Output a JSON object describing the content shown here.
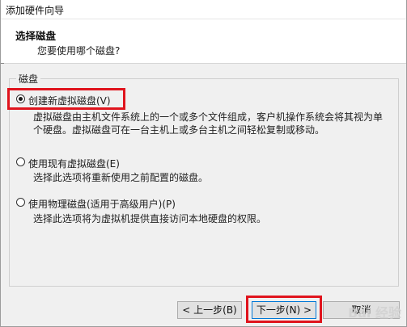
{
  "window": {
    "title": "添加硬件向导"
  },
  "header": {
    "title": "选择磁盘",
    "subtitle": "您要使用哪个磁盘?"
  },
  "group": {
    "label": "磁盘",
    "options": [
      {
        "label": "创建新虚拟磁盘(V)",
        "checked": true,
        "description_lines": [
          "虚拟磁盘由主机文件系统上的一个或多个文件组成，客户机操作系统会将其视为单",
          "个硬盘。虚拟磁盘可在一台主机上或多台主机之间轻松复制或移动。"
        ]
      },
      {
        "label": "使用现有虚拟磁盘(E)",
        "checked": false,
        "description_lines": [
          "选择此选项将重新使用之前配置的磁盘。"
        ]
      },
      {
        "label": "使用物理磁盘(适用于高级用户)(P)",
        "checked": false,
        "description_lines": [
          "选择此选项将为虚拟机提供直接访问本地硬盘的权限。"
        ]
      }
    ]
  },
  "buttons": {
    "back": "< 上一步(B)",
    "next": "下一步(N) >",
    "cancel": "取消"
  },
  "highlight_color": "#e0141d",
  "accent_color": "#0078d7"
}
